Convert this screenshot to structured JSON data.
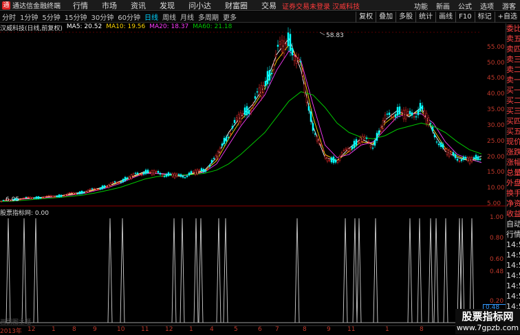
{
  "app": {
    "title": "通达信金融终端"
  },
  "menu": [
    "行情",
    "市场",
    "资讯",
    "发现",
    "问小达",
    "财富圈",
    "交易"
  ],
  "alert": "证券交易未登录  汉威科技",
  "top_right": [
    "功能",
    "新画",
    "公式",
    "选项",
    "游客"
  ],
  "periods": [
    "分时",
    "1分钟",
    "5分钟",
    "15分钟",
    "30分钟",
    "60分钟",
    "日线",
    "周线",
    "月线",
    "多周期",
    "更多"
  ],
  "active_period": "日线",
  "tools": [
    "复权",
    "叠加",
    "多股",
    "统计",
    "画线",
    "F10",
    "标记",
    "+自选"
  ],
  "chart_header": {
    "stock": "汉威科技(日线,前复权)",
    "ma5": "MA5: 20.52",
    "ma10": "MA10: 19.56",
    "ma20": "MA20: 18.37",
    "ma60": "MA60: 21.18",
    "colors": {
      "ma5": "#ffffff",
      "ma10": "#ffd700",
      "ma20": "#ff3cff",
      "ma60": "#00c800"
    }
  },
  "price_axis": [
    "55.00",
    "50.00",
    "45.00",
    "40.00",
    "35.00",
    "30.00",
    "25.00",
    "20.00",
    "15.00",
    "10.00",
    "5.00"
  ],
  "annotations": {
    "high": "58.83",
    "low": "6.05"
  },
  "indicator": {
    "name": "股票指标网: 0.00",
    "axis": [
      "1.00",
      "0.80",
      "0.60",
      "0.48",
      "0.20"
    ],
    "tag": "0.48"
  },
  "right_panel": [
    "委比",
    "卖五",
    "卖四",
    "卖三",
    "卖二",
    "卖一",
    "买一",
    "买二",
    "买三",
    "买四",
    "买五",
    "现价",
    "涨跌",
    "涨幅",
    "总量",
    "外盘",
    "换手",
    "净资",
    "收益",
    "自动",
    "行情",
    "14:50",
    "14:50",
    "14:50",
    "14:50",
    "14:50",
    "14:50",
    "14:50",
    "14:50"
  ],
  "dates": [
    "2013年",
    "12",
    "1",
    "8",
    "9",
    "10",
    "11",
    "12",
    "1",
    "4",
    "5",
    "6",
    "7",
    "8",
    "9",
    "11",
    "1",
    "8"
  ],
  "footer_hint": "画副图主题",
  "watermark": {
    "line1": "股票指标网",
    "line2": "www.7gpzb.com"
  },
  "chart_data": {
    "type": "line",
    "ylim": [
      5,
      60
    ],
    "series": [
      {
        "name": "MA5",
        "values": [
          6,
          6.5,
          7,
          7.2,
          7.5,
          7.8,
          8.5,
          9,
          10,
          11,
          12.5,
          14,
          15.5,
          15,
          14.5,
          14,
          15,
          16,
          20,
          28,
          33,
          37,
          43,
          53,
          58,
          48,
          30,
          20,
          19,
          23,
          26,
          24,
          32,
          35,
          33,
          36,
          28,
          22,
          20,
          19,
          20.5
        ]
      },
      {
        "name": "MA10",
        "values": [
          6,
          6.4,
          6.9,
          7.1,
          7.4,
          7.7,
          8.3,
          8.8,
          9.8,
          10.8,
          12.2,
          13.8,
          15.2,
          15,
          14.6,
          14.1,
          14.8,
          15.7,
          19,
          26,
          32,
          36,
          42,
          51,
          56,
          50,
          33,
          21,
          19,
          22,
          25,
          24.5,
          31,
          34,
          33.5,
          35,
          29,
          23,
          20.5,
          19,
          19.6
        ]
      },
      {
        "name": "MA20",
        "values": [
          6,
          6.3,
          6.8,
          7,
          7.3,
          7.6,
          8.1,
          8.6,
          9.5,
          10.5,
          11.8,
          13.5,
          15,
          15,
          14.7,
          14.2,
          14.6,
          15.4,
          18,
          24,
          30,
          35,
          40,
          48,
          54,
          51,
          37,
          24,
          20,
          21,
          24,
          25,
          29,
          33,
          34,
          34,
          31,
          25,
          21,
          19.5,
          18.4
        ]
      },
      {
        "name": "MA60",
        "values": [
          6,
          6.1,
          6.4,
          6.7,
          7,
          7.3,
          7.7,
          8.1,
          8.8,
          9.6,
          10.5,
          11.8,
          13.1,
          13.9,
          14.3,
          14.4,
          14.6,
          15,
          16,
          18,
          21,
          24.5,
          28,
          33,
          38,
          41,
          40,
          36,
          31,
          28,
          26.5,
          26,
          27,
          29,
          30,
          31,
          30,
          28,
          25,
          22.5,
          21.2
        ]
      }
    ],
    "indicator_spikes": [
      12,
      35,
      52,
      160,
      178,
      253,
      265,
      285,
      292,
      318,
      328,
      432,
      502,
      516,
      522,
      546,
      596,
      610,
      626,
      634,
      648,
      668,
      672,
      686
    ]
  }
}
